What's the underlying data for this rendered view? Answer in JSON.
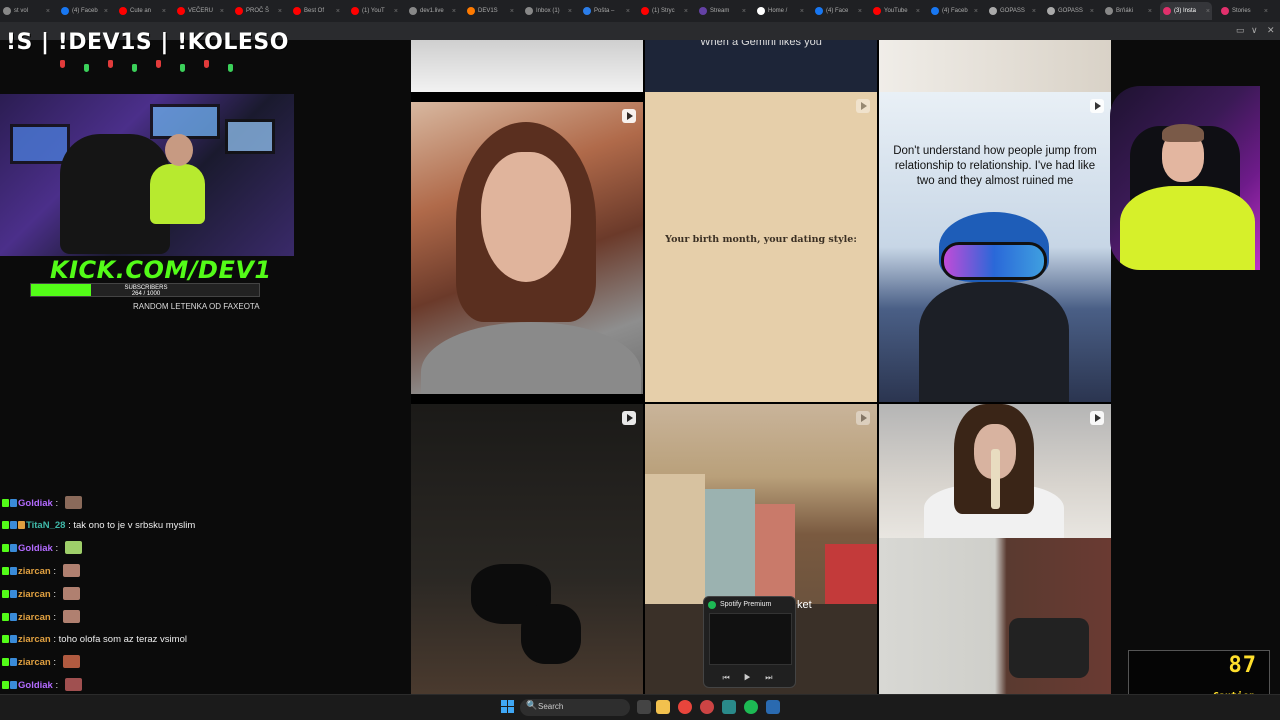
{
  "browser": {
    "tabs": [
      {
        "label": "st vol",
        "color": "#888888"
      },
      {
        "label": "(4) Faceb",
        "color": "#1877f2"
      },
      {
        "label": "Cute an",
        "color": "#ff0000"
      },
      {
        "label": "VEČERU",
        "color": "#ff0000"
      },
      {
        "label": "PROČ Š",
        "color": "#ff0000"
      },
      {
        "label": "Best Of",
        "color": "#ff0000"
      },
      {
        "label": "(1) YouT",
        "color": "#ff0000"
      },
      {
        "label": "dev1.live",
        "color": "#888888"
      },
      {
        "label": "DEV1S",
        "color": "#ff7a00"
      },
      {
        "label": "Inbox (1)",
        "color": "#888888"
      },
      {
        "label": "Pošta –",
        "color": "#2b7de9"
      },
      {
        "label": "(1) Stryc",
        "color": "#ff0000"
      },
      {
        "label": "Stream",
        "color": "#6441a5"
      },
      {
        "label": "Home /",
        "color": "#ffffff"
      },
      {
        "label": "(4) Face",
        "color": "#1877f2"
      },
      {
        "label": "YouTube",
        "color": "#ff0000"
      },
      {
        "label": "(4) Faceb",
        "color": "#1877f2"
      },
      {
        "label": "GOPASS",
        "color": "#aaaaaa"
      },
      {
        "label": "GOPASS",
        "color": "#aaaaaa"
      },
      {
        "label": "Brňáki",
        "color": "#888888"
      },
      {
        "label": "(3) Insta",
        "color": "#e1306c",
        "active": true
      },
      {
        "label": "Stories",
        "color": "#e1306c"
      }
    ],
    "close_glyph": "×",
    "window_controls": [
      "▭",
      "∨",
      "✕"
    ]
  },
  "overlay": {
    "commands": "!S | !DEV1S | !KOLESO",
    "kick_url": "KICK.COM/DEV1",
    "subscribers_label": "SUBSCRIBERS",
    "subscribers_count": "264 / 1000",
    "subscribers_progress": 0.264,
    "random_text": "RANDOM LETENKA OD FAXEOTA"
  },
  "chat": [
    {
      "user": "Goldiak",
      "user_color": "#b36bff",
      "text": "",
      "emote_color": "#8a6a5a"
    },
    {
      "user": "TitaN_28",
      "user_color": "#3fb8a8",
      "text": "tak ono to je v srbsku myslim",
      "emote_color": ""
    },
    {
      "user": "Goldiak",
      "user_color": "#b36bff",
      "text": "",
      "emote_color": "#9fcf6a"
    },
    {
      "user": "ziarcan",
      "user_color": "#e0a040",
      "text": "",
      "emote_color": "#b08070"
    },
    {
      "user": "ziarcan",
      "user_color": "#e0a040",
      "text": "",
      "emote_color": "#b08070"
    },
    {
      "user": "ziarcan",
      "user_color": "#e0a040",
      "text": "",
      "emote_color": "#b08070"
    },
    {
      "user": "ziarcan",
      "user_color": "#e0a040",
      "text": "toho olofa som az teraz vsimol",
      "emote_color": ""
    },
    {
      "user": "ziarcan",
      "user_color": "#e0a040",
      "text": "",
      "emote_color": "#b05a40"
    },
    {
      "user": "Goldiak",
      "user_color": "#b36bff",
      "text": "",
      "emote_color": "#a05050"
    }
  ],
  "grid": {
    "top_middle_caption": "When a Gemini likes you",
    "cream_caption": "Your birth month, your dating style:",
    "skier_caption": "Don't understand how people jump from relationship to relationship. I've had like two and they almost ruined me"
  },
  "spotify": {
    "title": "Spotify Premium",
    "controls": "⏮ ▶ ⏭",
    "partial_text": "ket"
  },
  "caution": {
    "value": "87",
    "label": "Caution",
    "color": "#ffdf2c"
  },
  "taskbar": {
    "search_label": "Search",
    "search_icon": "🔍"
  }
}
